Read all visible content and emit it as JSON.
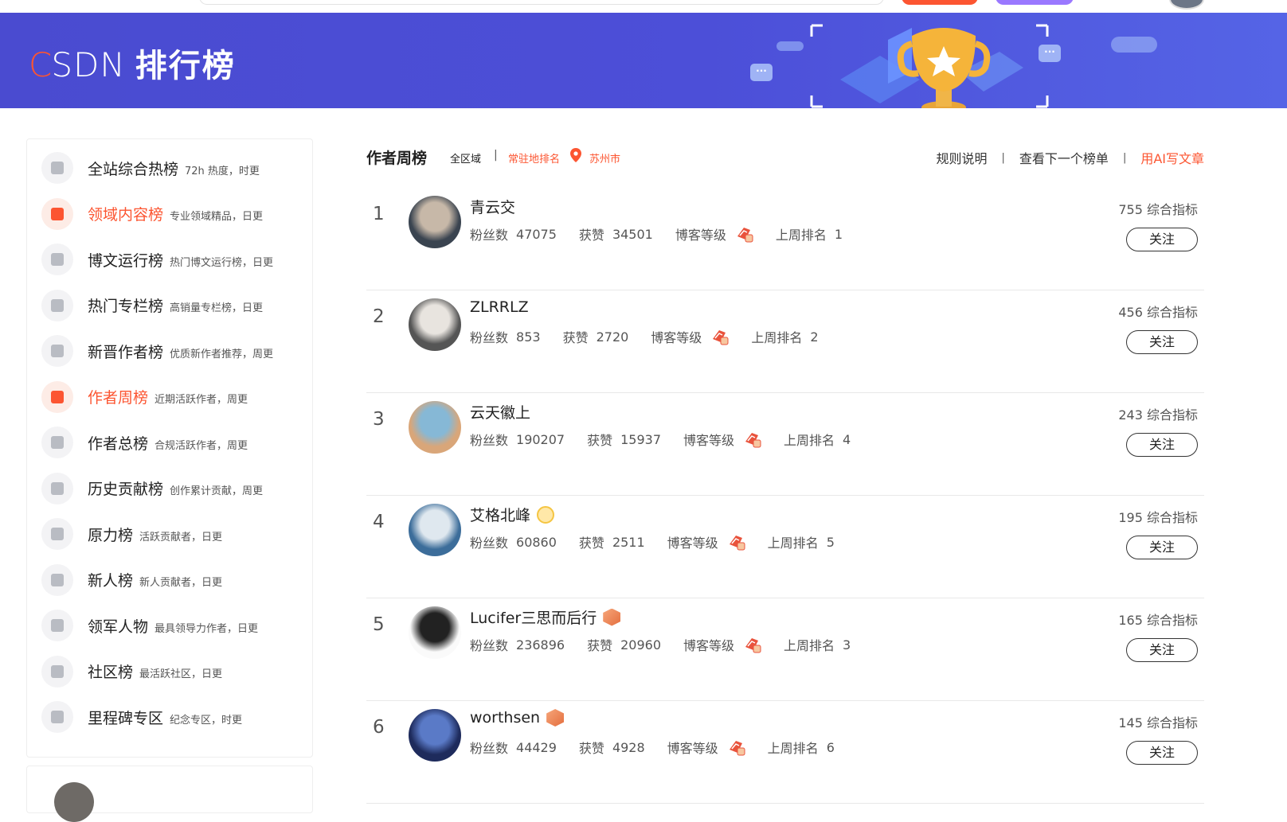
{
  "banner": {
    "logo_c": "C",
    "logo_sdn": "SDN",
    "logo_text": "排行榜"
  },
  "sidebar": {
    "items": [
      {
        "title": "全站综合热榜",
        "sub": "72h 热度，时更",
        "icon": "rocket-icon",
        "active": false
      },
      {
        "title": "领域内容榜",
        "sub": "专业领域精品，日更",
        "icon": "code-icon",
        "active": true
      },
      {
        "title": "博文运行榜",
        "sub": "热门博文运行榜，日更",
        "icon": "play-icon",
        "active": false
      },
      {
        "title": "热门专栏榜",
        "sub": "高销量专栏榜，日更",
        "icon": "book-icon",
        "active": false
      },
      {
        "title": "新晋作者榜",
        "sub": "优质新作者推荐，周更",
        "icon": "user-icon",
        "active": false
      },
      {
        "title": "作者周榜",
        "sub": "近期活跃作者，周更",
        "icon": "calendar-icon",
        "active": true
      },
      {
        "title": "作者总榜",
        "sub": "合规活跃作者，周更",
        "icon": "group-icon",
        "active": false
      },
      {
        "title": "历史贡献榜",
        "sub": "创作累计贡献，周更",
        "icon": "contribution-icon",
        "active": false
      },
      {
        "title": "原力榜",
        "sub": "活跃贡献者，日更",
        "icon": "force-icon",
        "active": false
      },
      {
        "title": "新人榜",
        "sub": "新人贡献者，日更",
        "icon": "newcomer-icon",
        "active": false
      },
      {
        "title": "领军人物",
        "sub": "最具领导力作者，日更",
        "icon": "medal-icon",
        "active": false
      },
      {
        "title": "社区榜",
        "sub": "最活跃社区，日更",
        "icon": "community-icon",
        "active": false
      },
      {
        "title": "里程碑专区",
        "sub": "纪念专区，时更",
        "icon": "milestone-icon",
        "active": false
      }
    ]
  },
  "header": {
    "title": "作者周榜",
    "region": "全区域",
    "sep": "|",
    "local_rank": "常驻地排名",
    "city": "苏州市",
    "rules": "规则说明",
    "next": "查看下一个榜单",
    "ai_write": "用AI写文章"
  },
  "labels": {
    "fans": "粉丝数",
    "likes": "获赞",
    "level": "博客等级",
    "last_rank": "上周排名",
    "score_suffix": "综合指标",
    "follow": "关注"
  },
  "ranks": [
    {
      "rank": "1",
      "name": "青云交",
      "fans": "47075",
      "likes": "34501",
      "last_rank": "1",
      "score": "755 综合指标",
      "badge": "",
      "avatar_colors": [
        "#3a4450",
        "#c7b8a8"
      ]
    },
    {
      "rank": "2",
      "name": "ZLRRLZ",
      "fans": "853",
      "likes": "2720",
      "last_rank": "2",
      "score": "456 综合指标",
      "badge": "",
      "avatar_colors": [
        "#555",
        "#e8e4df"
      ]
    },
    {
      "rank": "3",
      "name": "云天徽上",
      "fans": "190207",
      "likes": "15937",
      "last_rank": "4",
      "score": "243 综合指标",
      "badge": "",
      "avatar_colors": [
        "#d9a679",
        "#86b8d6"
      ]
    },
    {
      "rank": "4",
      "name": "艾格北峰",
      "fans": "60860",
      "likes": "2511",
      "last_rank": "5",
      "score": "195 综合指标",
      "badge": "crown",
      "avatar_colors": [
        "#3c6d9a",
        "#dfe8ef"
      ]
    },
    {
      "rank": "5",
      "name": "Lucifer三思而后行",
      "fans": "236896",
      "likes": "20960",
      "last_rank": "3",
      "score": "165 综合指标",
      "badge": "gem",
      "avatar_colors": [
        "#fafafa",
        "#222"
      ]
    },
    {
      "rank": "6",
      "name": "worthsen",
      "fans": "44429",
      "likes": "4928",
      "last_rank": "6",
      "score": "145 综合指标",
      "badge": "gem",
      "avatar_colors": [
        "#1e2b5c",
        "#5a7ac7"
      ]
    }
  ]
}
